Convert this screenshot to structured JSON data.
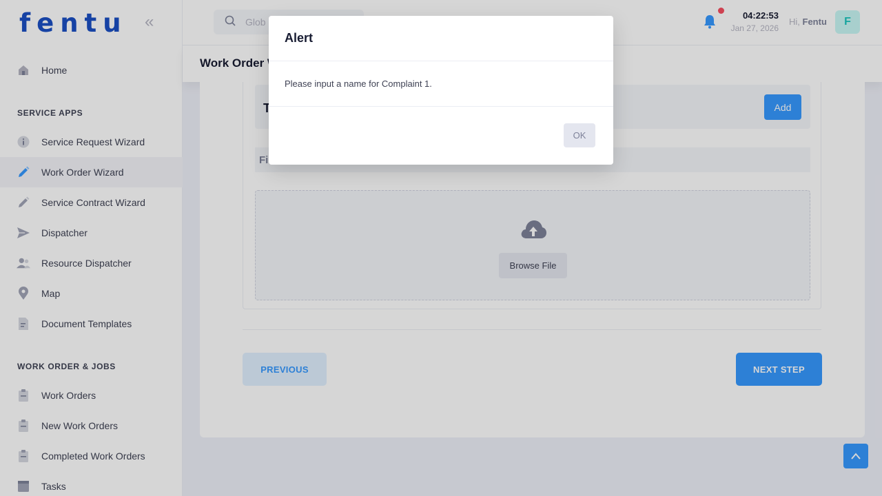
{
  "sidebar": {
    "logo": "fentu",
    "collapse_glyph": "«",
    "items": [
      {
        "label": "Home",
        "icon": "home-icon"
      },
      {
        "label": "Service Request Wizard",
        "icon": "info-icon"
      },
      {
        "label": "Work Order Wizard",
        "icon": "pen-icon"
      },
      {
        "label": "Service Contract Wizard",
        "icon": "pen-icon"
      },
      {
        "label": "Dispatcher",
        "icon": "send-icon"
      },
      {
        "label": "Resource Dispatcher",
        "icon": "users-icon"
      },
      {
        "label": "Map",
        "icon": "map-pin-icon"
      },
      {
        "label": "Document Templates",
        "icon": "document-icon"
      },
      {
        "label": "Work Orders",
        "icon": "clipboard-icon"
      },
      {
        "label": "New Work Orders",
        "icon": "clipboard-icon"
      },
      {
        "label": "Completed Work Orders",
        "icon": "clipboard-icon"
      },
      {
        "label": "Tasks",
        "icon": "book-icon"
      }
    ],
    "sections": {
      "service_apps": "SERVICE APPS",
      "work_order_jobs": "WORK ORDER & JOBS"
    }
  },
  "header": {
    "search_placeholder": "Glob",
    "time": "04:22:53",
    "date": "Jan 27, 2026",
    "greeting": "Hi,",
    "user_name": "Fentu",
    "avatar_initial": "F"
  },
  "subheader": {
    "title": "Work Order W"
  },
  "main": {
    "row_label": "T",
    "add_label": "Add",
    "file_label": "Fil",
    "browse_label": "Browse File",
    "previous_label": "PREVIOUS",
    "next_label": "NEXT STEP"
  },
  "modal": {
    "title": "Alert",
    "message": "Please input a name for Complaint 1.",
    "ok_label": "OK"
  },
  "colors": {
    "primary": "#3699ff",
    "brand": "#1b4fc4",
    "notification_dot": "#f64e60"
  }
}
